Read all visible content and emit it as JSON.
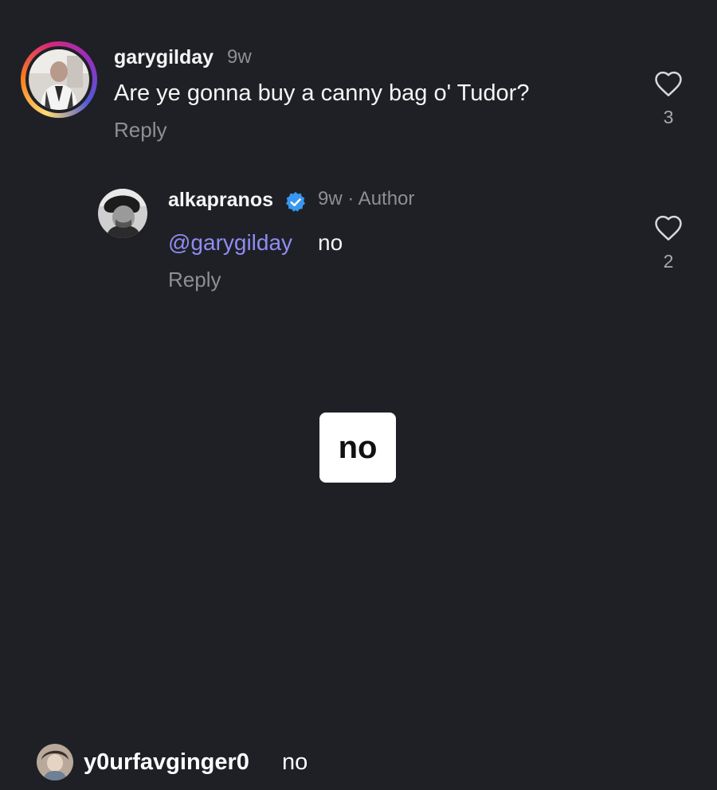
{
  "colors": {
    "background": "#1f2026",
    "primary_text": "#f5f5f5",
    "secondary_text": "#8e8e93",
    "mention": "#8f8cf2",
    "verified_badge": "#3897f0",
    "sticker_bg": "#ffffff"
  },
  "comments": [
    {
      "username": "garygilday",
      "time": "9w",
      "text": "Are ye gonna buy a canny bag o' Tudor?",
      "reply_label": "Reply",
      "like_count": "3",
      "like_icon": "heart-outline-icon",
      "has_story_ring": true
    },
    {
      "username": "alkapranos",
      "verified": true,
      "verified_icon": "verified-badge-icon",
      "time_author": "9w · Author",
      "mention": "@garygilday",
      "text": "no",
      "reply_label": "Reply",
      "like_count": "2",
      "like_icon": "heart-outline-icon"
    }
  ],
  "sticker": {
    "text": "no"
  },
  "viewer_comment": {
    "username": "y0urfavginger0",
    "text": "no"
  }
}
